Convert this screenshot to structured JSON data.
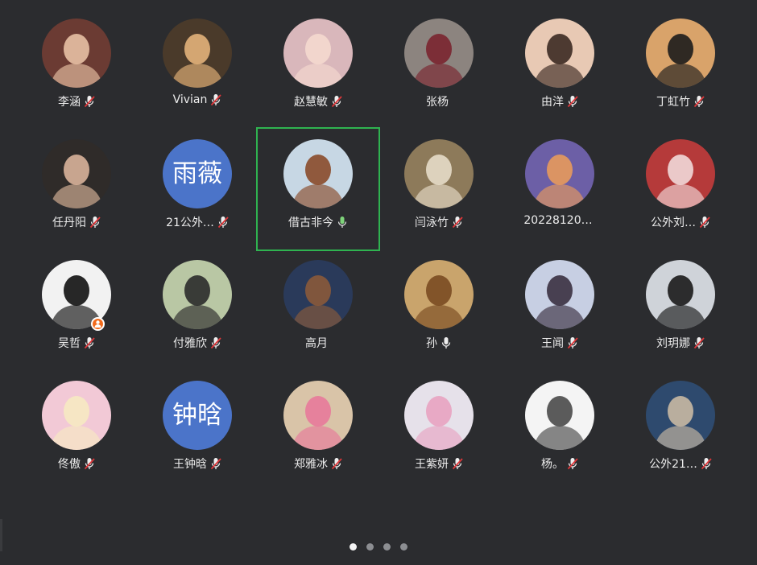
{
  "participants": [
    {
      "name": "李涵",
      "mic": "muted",
      "avatar": {
        "bg": "#6b3b33",
        "fg": "#e8c1a4"
      }
    },
    {
      "name": "Vivian",
      "mic": "muted",
      "avatar": {
        "bg": "#4a3a2a",
        "fg": "#e3b27a"
      }
    },
    {
      "name": "赵慧敏",
      "mic": "muted",
      "avatar": {
        "bg": "#d9b7bb",
        "fg": "#f4d9cf"
      }
    },
    {
      "name": "张杨",
      "mic": "muted_hidden",
      "avatar": {
        "bg": "#8c847f",
        "fg": "#7a2530"
      }
    },
    {
      "name": "由洋",
      "mic": "muted",
      "avatar": {
        "bg": "#e8c9b4",
        "fg": "#3c2a22"
      }
    },
    {
      "name": "丁虹竹",
      "mic": "muted",
      "avatar": {
        "bg": "#d9a36a",
        "fg": "#1c1c1c"
      }
    },
    {
      "name": "任丹阳",
      "mic": "muted",
      "avatar": {
        "bg": "#2f2b29",
        "fg": "#d9b39a"
      }
    },
    {
      "name": "21公外…",
      "mic": "muted",
      "avatar": {
        "text": "雨薇",
        "bg": "#4b74c9"
      }
    },
    {
      "name": "借古非今",
      "mic": "active",
      "avatar": {
        "bg": "#c7d7e4",
        "fg": "#8a4b2a"
      }
    },
    {
      "name": "闫泳竹",
      "mic": "muted",
      "avatar": {
        "bg": "#8d7a5a",
        "fg": "#e6dcc8"
      }
    },
    {
      "name": "20228120…",
      "mic": "none",
      "avatar": {
        "bg": "#6c5fa6",
        "fg": "#e89a5c"
      }
    },
    {
      "name": "公外刘…",
      "mic": "muted",
      "avatar": {
        "bg": "#b53a3a",
        "fg": "#f1d9d9"
      }
    },
    {
      "name": "吴哲",
      "mic": "muted",
      "host": true,
      "avatar": {
        "bg": "#f2f2f2",
        "fg": "#111111"
      }
    },
    {
      "name": "付雅欣",
      "mic": "muted",
      "avatar": {
        "bg": "#b9c7a4",
        "fg": "#2b2b2b"
      }
    },
    {
      "name": "高月",
      "mic": "none",
      "avatar": {
        "bg": "#2a3a5a",
        "fg": "#8a5a3a"
      }
    },
    {
      "name": "孙",
      "mic": "on",
      "avatar": {
        "bg": "#c9a46c",
        "fg": "#7a4b22"
      }
    },
    {
      "name": "王闻",
      "mic": "muted",
      "avatar": {
        "bg": "#c7cfe3",
        "fg": "#3a3040"
      }
    },
    {
      "name": "刘玥娜",
      "mic": "muted",
      "avatar": {
        "bg": "#cfd3d9",
        "fg": "#1a1a1a"
      }
    },
    {
      "name": "佟傲",
      "mic": "muted",
      "avatar": {
        "bg": "#f2c9d6",
        "fg": "#f6e9c2"
      }
    },
    {
      "name": "王钟晗",
      "mic": "muted",
      "avatar": {
        "text": "钟晗",
        "bg": "#4b74c9"
      }
    },
    {
      "name": "郑雅冰",
      "mic": "muted",
      "avatar": {
        "bg": "#d9c4a8",
        "fg": "#e77a9a"
      }
    },
    {
      "name": "王紫妍",
      "mic": "muted",
      "avatar": {
        "bg": "#e6e1ea",
        "fg": "#e8a3c1"
      }
    },
    {
      "name": "杨。",
      "mic": "muted",
      "avatar": {
        "bg": "#f4f4f4",
        "fg": "#4a4a4a"
      }
    },
    {
      "name": "公外21…",
      "mic": "muted",
      "avatar": {
        "bg": "#2e4a6e",
        "fg": "#c9b9a3"
      }
    }
  ],
  "active_speaker": 8,
  "pager": {
    "pages": 4,
    "current": 1
  },
  "colors": {
    "background": "#2b2c2f",
    "active_border": "#2fb350",
    "mic_on": "#7ed37a",
    "mic_muted_red": "#e0373a",
    "host_badge": "#f26a1b"
  }
}
